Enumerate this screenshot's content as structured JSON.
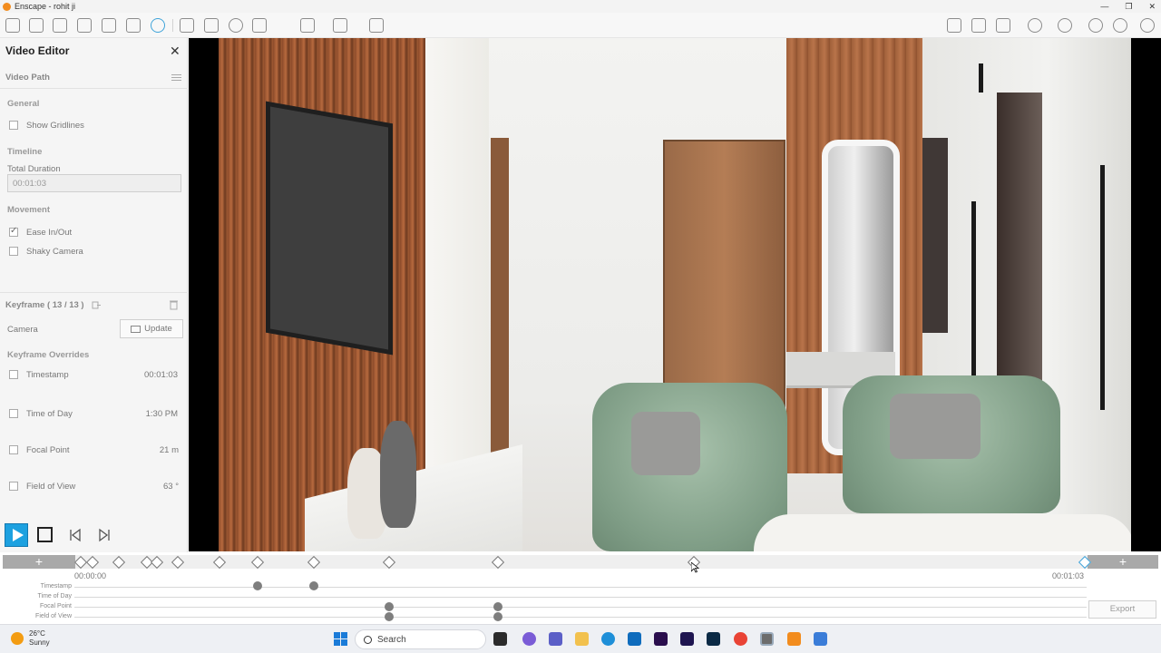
{
  "window": {
    "title": "Enscape - rohit ji"
  },
  "panel": {
    "title": "Video Editor",
    "video_path_label": "Video Path",
    "general": {
      "heading": "General",
      "show_gridlines": "Show Gridlines"
    },
    "timeline_section": {
      "heading": "Timeline",
      "total_duration_label": "Total Duration",
      "total_duration_value": "00:01:03"
    },
    "movement": {
      "heading": "Movement",
      "ease": "Ease In/Out",
      "shaky": "Shaky Camera"
    },
    "keyframe": {
      "heading": "Keyframe ( 13 / 13 )",
      "camera_label": "Camera",
      "update_label": "Update",
      "overrides_heading": "Keyframe Overrides",
      "overrides": [
        {
          "label": "Timestamp",
          "value": "00:01:03"
        },
        {
          "label": "Time of Day",
          "value": "1:30 PM"
        },
        {
          "label": "Focal Point",
          "value": "21 m"
        },
        {
          "label": "Field of View",
          "value": "63 °"
        }
      ]
    }
  },
  "timeline": {
    "start_time": "00:00:00",
    "end_time": "00:01:03",
    "tracks": [
      "Timestamp",
      "Time of Day",
      "Focal Point",
      "Field of View"
    ],
    "export_label": "Export",
    "add_symbol": "+"
  },
  "taskbar": {
    "temperature": "26°C",
    "condition": "Sunny",
    "search_placeholder": "Search"
  },
  "colors": {
    "accent": "#1da1e0",
    "keyframe_end": "#3fa3d9"
  }
}
